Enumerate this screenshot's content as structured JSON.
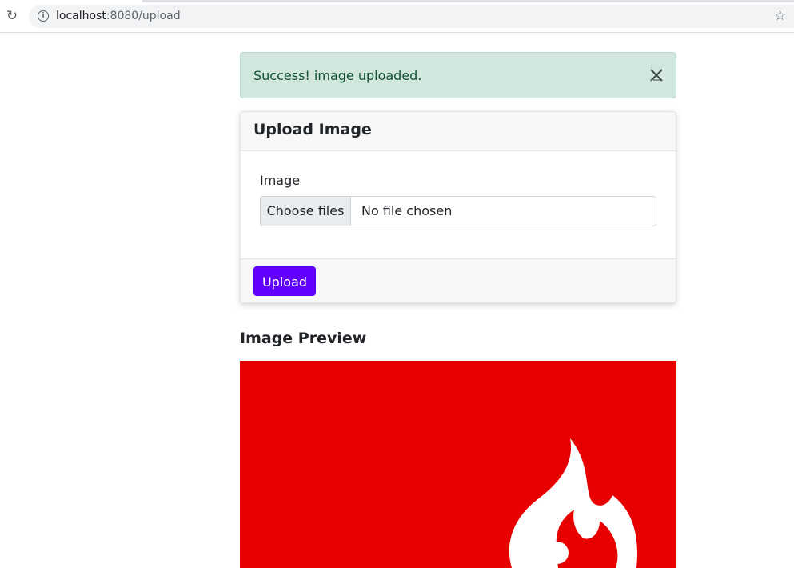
{
  "browser": {
    "url_host": "localhost",
    "url_rest": ":8080/upload",
    "reload_icon": "reload-icon",
    "info_icon": "info-icon",
    "bookmark_icon": "star-icon"
  },
  "alert": {
    "message": "Success! image uploaded.",
    "close_icon": "close-icon",
    "color": "#0f5132",
    "background": "#d1e7dd"
  },
  "upload_card": {
    "title": "Upload Image",
    "field_label": "Image",
    "file_button_label": "Choose files",
    "file_status": "No file chosen",
    "submit_label": "Upload",
    "submit_color": "#6200ff"
  },
  "preview": {
    "heading": "Image Preview",
    "image_icon": "codeigniter-flame-logo",
    "image_background": "#e80000"
  }
}
